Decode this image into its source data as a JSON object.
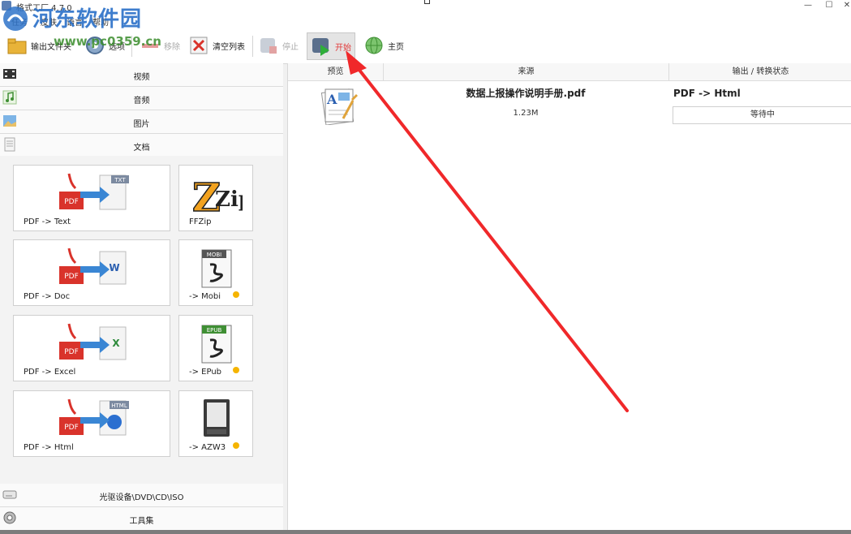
{
  "window": {
    "title": "格式工厂 4.7.0",
    "minimize": "—",
    "maximize": "☐",
    "close": "✕"
  },
  "menu": [
    "任务",
    "皮肤",
    "语言",
    "帮助"
  ],
  "watermark": {
    "title": "河东软件园",
    "url": "www.pc0359.cn"
  },
  "toolbar": {
    "output_folder": "输出文件夹",
    "options": "选项",
    "remove": "移除",
    "clear_list": "清空列表",
    "stop": "停止",
    "start": "开始",
    "home": "主页"
  },
  "categories": {
    "video": "视频",
    "audio": "音频",
    "image": "图片",
    "document": "文档",
    "rom_device": "光驱设备\\DVD\\CD\\ISO",
    "toolbox": "工具集"
  },
  "tiles": {
    "pdf_text": "PDF -> Text",
    "ffzip": "FFZip",
    "pdf_doc": "PDF -> Doc",
    "mobi": "-> Mobi",
    "pdf_excel": "PDF -> Excel",
    "epub": "-> EPub",
    "pdf_html": "PDF -> Html",
    "azw3": "-> AZW3",
    "badges": {
      "pdf": "PDF",
      "txt": "TXT",
      "word": "W",
      "excel": "X",
      "html": "HTML",
      "mobi": "MOBI",
      "epub": "EPUB",
      "zip": "Zip"
    }
  },
  "table": {
    "columns": [
      "预览",
      "来源",
      "输出 / 转换状态"
    ],
    "rows": [
      {
        "file": "数据上报操作说明手册.pdf",
        "size": "1.23M",
        "conversion": "PDF -> Html",
        "status": "等待中"
      }
    ]
  },
  "colors": {
    "accent_red": "#e23b3b",
    "arrow_red": "#f0282a",
    "pdf_red": "#d9332b",
    "watermark_blue": "#2e73c9",
    "watermark_green": "#3a8d2c"
  }
}
